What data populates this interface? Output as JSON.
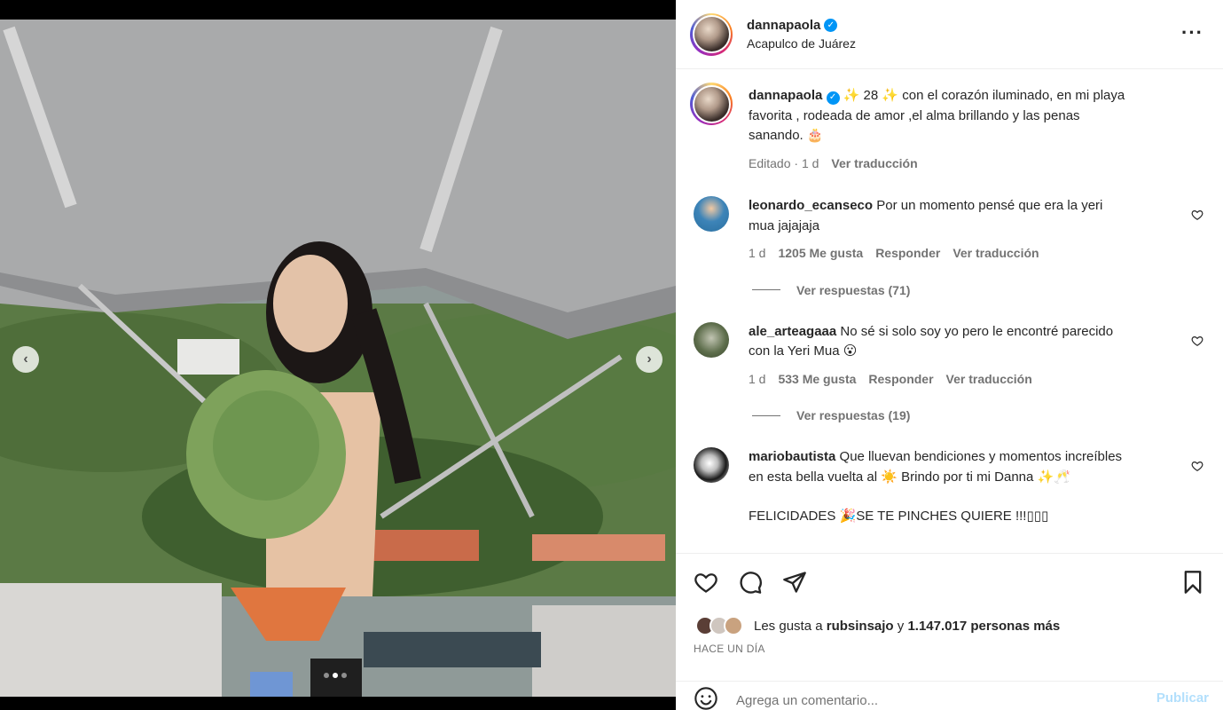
{
  "post": {
    "author": "dannapaola",
    "location": "Acapulco de Juárez",
    "caption": {
      "line1": "✨ 28 ✨ con el corazón iluminado, en mi playa",
      "line2": "favorita , rodeada de amor ,el alma brillando y las penas",
      "line3": "sanando. 🎂",
      "edited": "Editado",
      "time": "1 d",
      "translate": "Ver traducción"
    }
  },
  "comments": [
    {
      "user": "leonardo_ecanseco",
      "text1": "Por un momento pensé que era la yeri",
      "text2": "mua jajajaja",
      "time": "1 d",
      "likes": "1205 Me gusta",
      "reply": "Responder",
      "translate": "Ver traducción",
      "replies": "Ver respuestas (71)"
    },
    {
      "user": "ale_arteagaaa",
      "text1": "No sé si solo soy yo pero le encontré parecido",
      "text2": "con la Yeri Mua 😮",
      "time": "1 d",
      "likes": "533 Me gusta",
      "reply": "Responder",
      "translate": "Ver traducción",
      "replies": "Ver respuestas (19)"
    },
    {
      "user": "mariobautista",
      "text1": "Que lluevan bendiciones y momentos increíbles",
      "text2": "en esta bella vuelta al ☀️ Brindo por ti mi Danna ✨🥂",
      "text3": "FELICIDADES 🎉SE TE PINCHES QUIERE !!!▯▯▯"
    }
  ],
  "likes_line": {
    "prefix": "Les gusta a",
    "user": "rubsinsajo",
    "and": "y",
    "count": "1.147.017 personas más"
  },
  "time_ago": "HACE UN DÍA",
  "comment_box": {
    "placeholder": "Agrega un comentario...",
    "post_label": "Publicar"
  },
  "carousel": {
    "prev_icon": "chevron-left-icon",
    "next_icon": "chevron-right-icon",
    "current": 2,
    "total": 3
  },
  "colors": {
    "verified": "#0095f6",
    "publish_disabled": "#b2dffc",
    "muted": "#737373"
  }
}
